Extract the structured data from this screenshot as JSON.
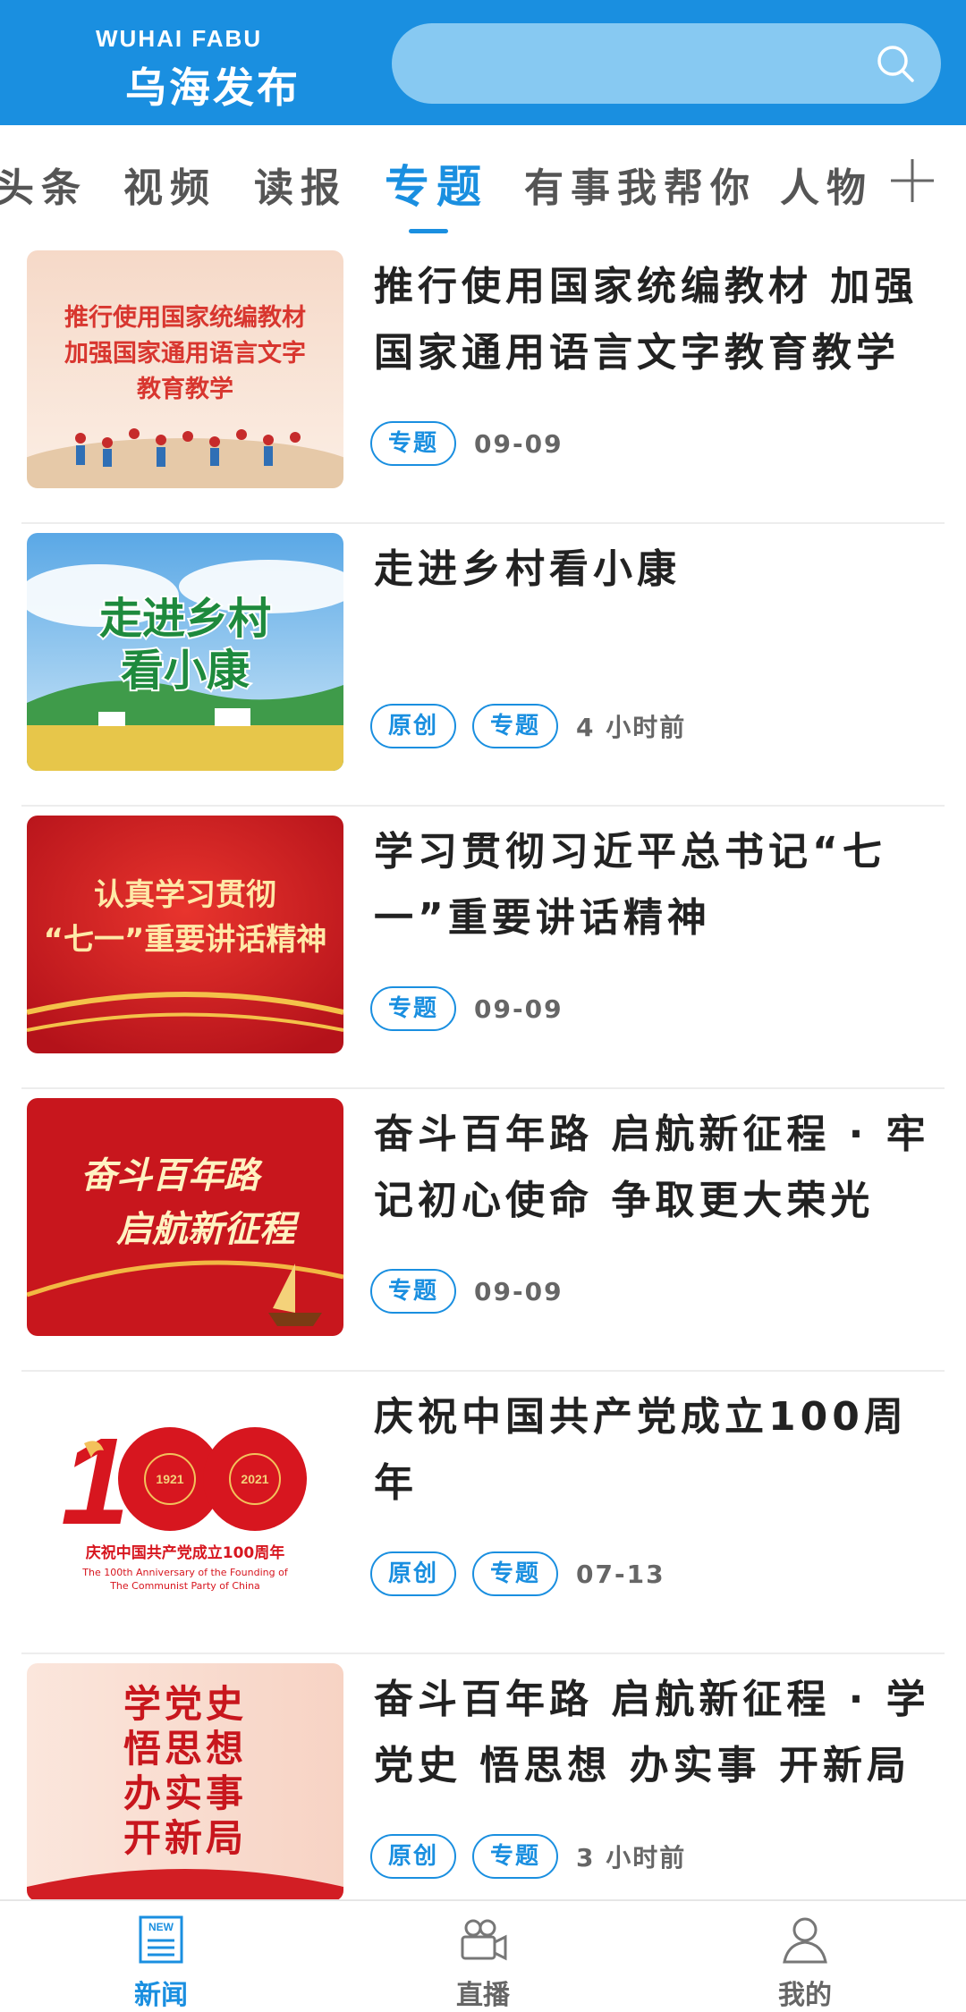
{
  "header": {
    "logo_en": "WUHAI FABU",
    "logo_cn": "乌海发布",
    "search_placeholder": ""
  },
  "tabs": [
    {
      "label": "头条",
      "active": false
    },
    {
      "label": "视频",
      "active": false
    },
    {
      "label": "读报",
      "active": false
    },
    {
      "label": "专题",
      "active": true
    },
    {
      "label": "有事我帮你",
      "active": false
    },
    {
      "label": "人物",
      "active": false
    }
  ],
  "news": [
    {
      "title": "推行使用国家统编教材 加强国家通用语言文字教育教学",
      "thumb_text": [
        "推行使用国家统编教材",
        "加强国家通用语言文字",
        "教育教学"
      ],
      "tags": [
        "专题"
      ],
      "time": "09-09"
    },
    {
      "title": "走进乡村看小康",
      "thumb_text": [
        "走进乡村",
        "看小康"
      ],
      "tags": [
        "原创",
        "专题"
      ],
      "time": "4 小时前"
    },
    {
      "title": "学习贯彻习近平总书记“七一”重要讲话精神",
      "thumb_text": [
        "认真学习贯彻",
        "“七一”重要讲话精神"
      ],
      "tags": [
        "专题"
      ],
      "time": "09-09"
    },
    {
      "title": "奋斗百年路 启航新征程 · 牢记初心使命 争取更大荣光",
      "thumb_text": [
        "奋斗百年路",
        "启航新征程"
      ],
      "tags": [
        "专题"
      ],
      "time": "09-09"
    },
    {
      "title": "庆祝中国共产党成立100周年",
      "thumb_text": [
        "1921",
        "2021",
        "庆祝中国共产党成立100周年",
        "The 100th Anniversary of the Founding of",
        "The Communist Party of China"
      ],
      "tags": [
        "原创",
        "专题"
      ],
      "time": "07-13"
    },
    {
      "title": "奋斗百年路 启航新征程 · 学党史 悟思想 办实事 开新局",
      "thumb_text": [
        "学党史",
        "悟思想",
        "办实事",
        "开新局"
      ],
      "tags": [
        "原创",
        "专题"
      ],
      "time": "3 小时前"
    }
  ],
  "bottom_nav": [
    {
      "label": "新闻",
      "icon": "news-icon",
      "badge": "NEW",
      "active": true
    },
    {
      "label": "直播",
      "icon": "live-camera-icon",
      "active": false
    },
    {
      "label": "我的",
      "icon": "user-icon",
      "active": false
    }
  ],
  "colors": {
    "primary": "#1a8fe0",
    "search_bg": "#87c9f2"
  }
}
